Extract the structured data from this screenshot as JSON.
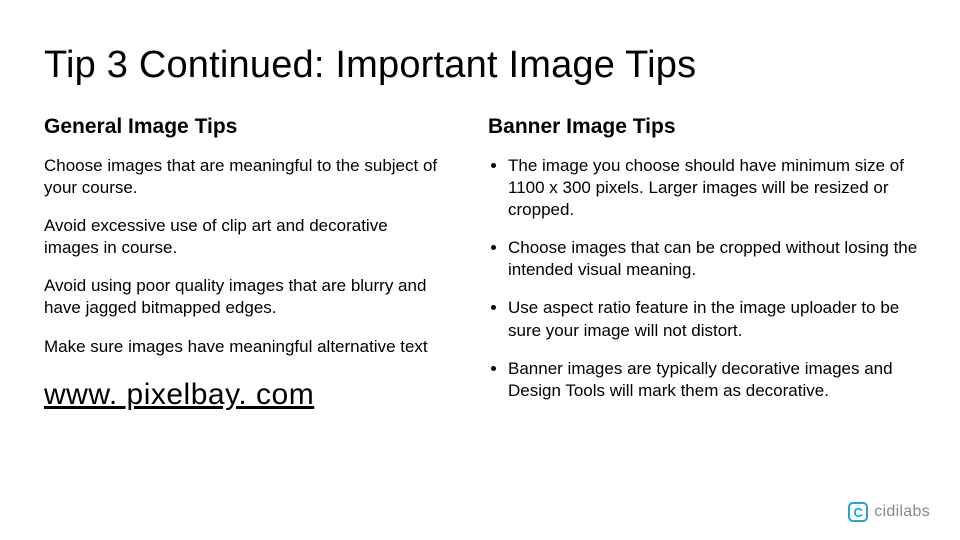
{
  "title": "Tip 3 Continued: Important Image Tips",
  "left": {
    "heading": "General Image Tips",
    "p1": "Choose images that are meaningful to the subject of your course.",
    "p2": "Avoid excessive use of clip art and decorative images in course.",
    "p3": "Avoid using poor quality images that are blurry and have jagged bitmapped edges.",
    "p4": "Make sure images have meaningful alternative text",
    "link": "www. pixelbay. com"
  },
  "right": {
    "heading": "Banner Image Tips",
    "b1": "The image you choose should have minimum size of 1100 x 300 pixels. Larger images will be resized or cropped.",
    "b2": "Choose images that can be cropped without losing the intended visual meaning.",
    "b3": "Use aspect ratio feature in the image uploader to be sure your image will not distort.",
    "b4": "Banner images are typically decorative images and Design Tools will mark them as decorative."
  },
  "logo": {
    "mark": "C",
    "text": "cidilabs"
  }
}
